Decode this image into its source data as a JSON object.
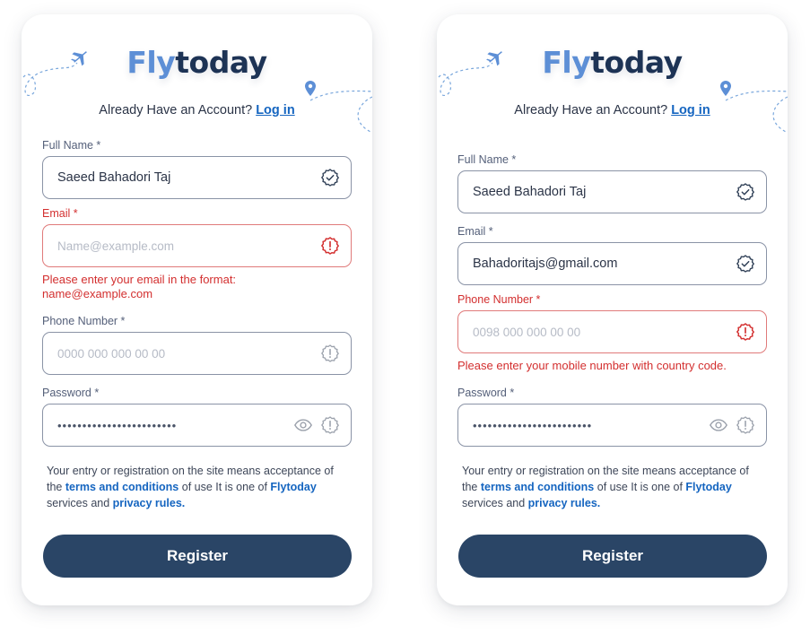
{
  "colors": {
    "logo_light": "#5d8fd6",
    "logo_dark": "#1d3355",
    "link": "#1565c0",
    "error": "#d32f2f",
    "button": "#2a4566"
  },
  "cards": [
    {
      "logo": {
        "part1": "Fly",
        "part2": "today"
      },
      "already_text": "Already Have an Account?",
      "login_link": "Log in",
      "fields": {
        "full_name": {
          "label": "Full Name *",
          "value": "Saeed Bahadori Taj",
          "state": "valid",
          "icon": "check-badge-icon"
        },
        "email": {
          "label": "Email *",
          "placeholder": "Name@example.com",
          "state": "error",
          "icon": "alert-badge-icon",
          "error_line1": "Please enter your email in the format:",
          "error_line2": "name@example.com"
        },
        "phone": {
          "label": "Phone Number *",
          "placeholder": "0000 000 000 00 00",
          "state": "neutral",
          "icon": "alert-badge-icon"
        },
        "password": {
          "label": "Password *",
          "value": "••••••••••••••••••••••••",
          "state": "neutral",
          "icons": [
            "eye-icon",
            "alert-badge-icon"
          ]
        }
      },
      "terms": {
        "t1": "Your entry or registration on the site means acceptance of the ",
        "link1": "terms and conditions",
        "t2": " of use It is one of ",
        "link2": "Flytoday",
        "t3": " services and ",
        "link3": "privacy rules."
      },
      "register_label": "Register"
    },
    {
      "logo": {
        "part1": "Fly",
        "part2": "today"
      },
      "already_text": "Already Have an Account?",
      "login_link": "Log in",
      "fields": {
        "full_name": {
          "label": "Full Name *",
          "value": "Saeed Bahadori Taj",
          "state": "valid",
          "icon": "check-badge-icon"
        },
        "email": {
          "label": "Email *",
          "value": "Bahadoritajs@gmail.com",
          "state": "valid",
          "icon": "check-badge-icon"
        },
        "phone": {
          "label": "Phone Number *",
          "placeholder": "0098 000 000 00 00",
          "state": "error",
          "icon": "alert-badge-icon",
          "error_line1": "Please enter your mobile number with country code."
        },
        "password": {
          "label": "Password *",
          "value": "••••••••••••••••••••••••",
          "state": "neutral",
          "icons": [
            "eye-icon",
            "alert-badge-icon"
          ]
        }
      },
      "terms": {
        "t1": "Your entry or registration on the site means acceptance of the ",
        "link1": "terms and conditions",
        "t2": " of use It is one of ",
        "link2": "Flytoday",
        "t3": " services and ",
        "link3": "privacy rules."
      },
      "register_label": "Register"
    }
  ]
}
